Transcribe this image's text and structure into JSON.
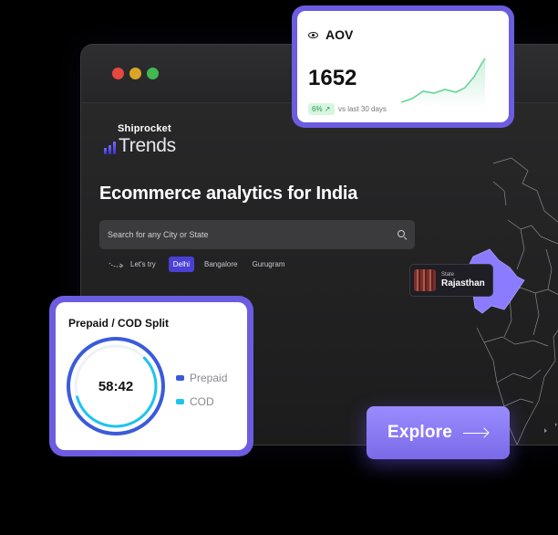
{
  "brand": {
    "top": "Shiprocket",
    "name": "Trends"
  },
  "headline": "Ecommerce analytics for India",
  "search": {
    "placeholder": "Search for any City or State"
  },
  "lets_try": {
    "label": "Let's try",
    "chips": [
      "Delhi",
      "Bangalore",
      "Gurugram"
    ],
    "active": "Delhi"
  },
  "state_badge": {
    "label": "State",
    "name": "Rajasthan"
  },
  "aov_card": {
    "title": "AOV",
    "value": "1652",
    "change": "6% ↗",
    "comparison": "vs last 30 days",
    "trend_color": "#6ad39a"
  },
  "split_card": {
    "title": "Prepaid / COD Split",
    "center": "58:42",
    "prepaid_share": 0.58,
    "legend": [
      {
        "label": "Prepaid",
        "color": "#3a5bd9"
      },
      {
        "label": "COD",
        "color": "#1ec3f0"
      }
    ]
  },
  "explore": {
    "label": "Explore"
  },
  "colors": {
    "accent": "#6c5ce0",
    "highlight_state": "#8b7bff"
  }
}
